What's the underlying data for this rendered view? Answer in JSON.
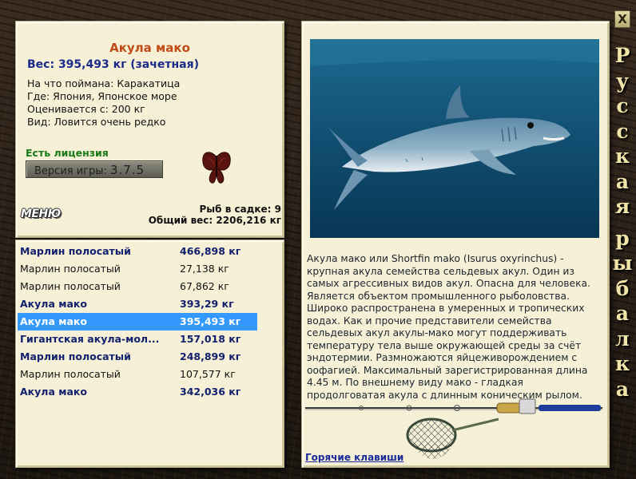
{
  "window": {
    "close_label": "X",
    "side_title_letters": [
      "Р",
      "у",
      "с",
      "с",
      "к",
      "а",
      "я",
      " ",
      "р",
      "ы",
      "б",
      "а",
      "л",
      "к",
      "а"
    ]
  },
  "info": {
    "title": "Акула мако",
    "weight": "Вес: 395,493 кг (зачетная)",
    "bait": "На что поймана: Каракатица",
    "place": "Где: Япония, Японское море",
    "price": "Оценивается с: 200 кг",
    "rarity": "Вид: Ловится очень редко",
    "license": "Есть лицензия",
    "version_label": "Версия игры:",
    "version_value": "3.7.5",
    "menu_label": "МЕНЮ",
    "fish_in_cage": "Рыб в садке: 9",
    "total_weight": "Общий вес: 2206,216 кг"
  },
  "catch_list": [
    {
      "name": "Марлин полосатый",
      "weight": "466,898 кг",
      "style": "bold"
    },
    {
      "name": "Марлин полосатый",
      "weight": "27,138 кг",
      "style": "plain"
    },
    {
      "name": "Марлин полосатый",
      "weight": "67,862 кг",
      "style": "plain"
    },
    {
      "name": "Акула мако",
      "weight": "393,29 кг",
      "style": "bold"
    },
    {
      "name": "Акула мако",
      "weight": "395,493 кг",
      "style": "selected"
    },
    {
      "name": "Гигантская акула-мол...",
      "weight": "157,018 кг",
      "style": "bold"
    },
    {
      "name": "Марлин полосатый",
      "weight": "248,899 кг",
      "style": "bold"
    },
    {
      "name": "Марлин полосатый",
      "weight": "107,577 кг",
      "style": "plain"
    },
    {
      "name": "Акула мако",
      "weight": "342,036 кг",
      "style": "bold"
    }
  ],
  "detail": {
    "photo_icon": "mako-shark-photo",
    "description": "Акула мако или Shortfin mako (Isurus oxyrinchus) - крупная акула семейства сельдевых акул. Один из самых агрессивных видов акул. Опасна для человека. Является объектом промышленного рыболовства. Широко распространена в умеренных и тропических водах. Как и прочие представители семейства сельдевых акул акулы-мако могут поддерживать температуру тела выше окружающей среды за счёт эндотермии. Размножаются яйцеживорождением с оофагией. Максимальный зарегистрированная длина 4.45 м. По внешнему виду мако - гладкая продолговатая акула с длинным коническим рылом.",
    "hotkeys_label": "Горячие клавиши",
    "rod_icon": "fishing-rod-icon",
    "net_icon": "landing-net-icon"
  },
  "colors": {
    "panel_bg": "#f6f1d6",
    "title": "#c24a16",
    "bold_row": "#12206e",
    "selected_row": "#3399ff",
    "license": "#1a7a1a"
  }
}
